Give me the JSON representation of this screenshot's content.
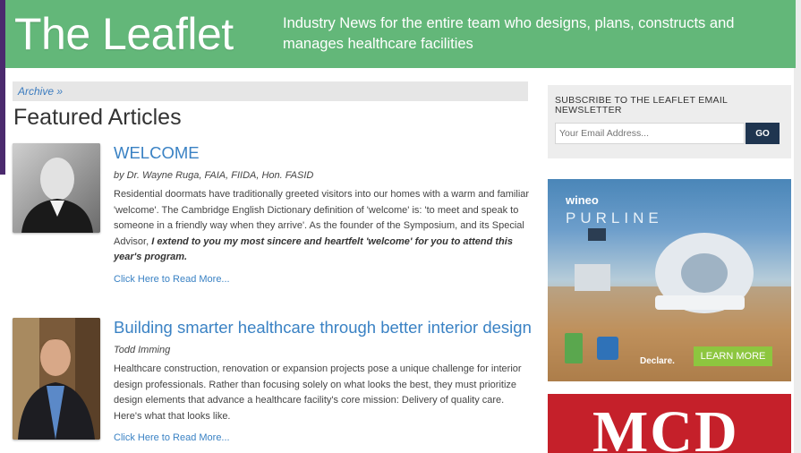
{
  "header": {
    "logo": "The Leaflet",
    "tagline": "Industry News for the entire team who designs, plans, constructs and manages healthcare facilities"
  },
  "breadcrumb": {
    "archive_link": "Archive »"
  },
  "main": {
    "title": "Featured Articles",
    "articles": [
      {
        "title": "WELCOME",
        "byline": "by Dr. Wayne Ruga, FAIA, FIIDA, Hon. FASID",
        "excerpt": "Residential doormats have traditionally greeted visitors into our homes with a warm and familiar 'welcome'. The Cambridge English Dictionary definition of 'welcome' is: 'to meet and speak to someone in a friendly way when they arrive'. As the founder of the Symposium, and its Special Advisor,",
        "excerpt_emphasis": "I extend to you my most sincere and heartfelt 'welcome' for you to attend this year's program.",
        "read_more": "Click Here to Read More..."
      },
      {
        "title": "Building smarter healthcare through better interior design",
        "byline": "Todd Imming",
        "excerpt": "Healthcare construction, renovation or expansion projects pose a unique challenge for interior design professionals. Rather than focusing solely on what looks the best, they must prioritize design elements that advance a healthcare facility's core mission: Delivery of quality care. Here's what that looks like.",
        "read_more": "Click Here to Read More..."
      }
    ]
  },
  "sidebar": {
    "subscribe_heading": "SUBSCRIBE TO THE LEAFLET EMAIL NEWSLETTER",
    "email_placeholder": "Your Email Address...",
    "go_label": "GO",
    "ad1": {
      "brand": "wineo",
      "product": "PURLINE",
      "partner": "Declare.",
      "cta": "LEARN MORE"
    },
    "ad2": {
      "logo": "MCD"
    }
  },
  "colors": {
    "header_green": "#63b779",
    "link_blue": "#3a82c4",
    "frame_purple": "#4b2a6e",
    "go_button": "#1f3550",
    "mcd_red": "#c5202a"
  }
}
